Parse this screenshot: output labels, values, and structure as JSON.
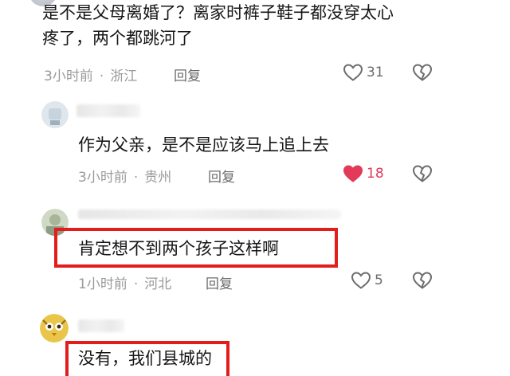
{
  "comments": [
    {
      "text_line1": "是不是父母离婚了？离家时裤子鞋子都没穿太心",
      "text_line2": "疼了，两个都跳河了",
      "time": "3小时前",
      "location": "浙江",
      "reply_label": "回复",
      "likes": "31",
      "liked": false
    },
    {
      "text": "作为父亲，是不是应该马上追上去",
      "time": "3小时前",
      "location": "贵州",
      "reply_label": "回复",
      "likes": "18",
      "liked": true
    },
    {
      "text": "肯定想不到两个孩子这样啊",
      "time": "1小时前",
      "location": "河北",
      "reply_label": "回复",
      "likes": "5",
      "liked": false
    },
    {
      "text": "没有，我们县城的"
    }
  ],
  "meta_separator": "·",
  "icons": {
    "like": "heart-outline-icon",
    "like_active": "heart-filled-icon",
    "dislike": "broken-heart-icon"
  },
  "colors": {
    "like_active": "#e23a58",
    "highlight_box": "#e31c1c",
    "meta_text": "#9a9a9a"
  }
}
